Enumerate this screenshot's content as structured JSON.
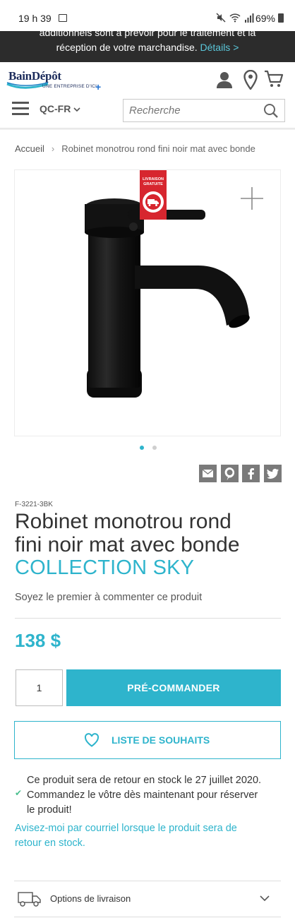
{
  "status_bar": {
    "time": "19 h 39",
    "battery": "69%"
  },
  "banner": {
    "line1": "additionnels sont à prévoir pour le traitement et la",
    "line2": "réception de votre marchandise.",
    "link": "Détails >"
  },
  "header": {
    "logo_text": "BainDépôt",
    "logo_sub": "UNE ENTREPRISE D'ICI",
    "lang": "QC-FR",
    "search_placeholder": "Recherche"
  },
  "breadcrumb": {
    "home": "Accueil",
    "current": "Robinet monotrou rond fini noir mat avec bonde"
  },
  "gallery": {
    "badge_line1": "LIVRAISON",
    "badge_line2": "GRATUITE",
    "active_dot": 0,
    "dot_count": 2,
    "accent": "#2eb4cc",
    "badge_color": "#d7262f"
  },
  "product": {
    "sku": "F-3221-3BK",
    "title_line1": "Robinet monotrou rond",
    "title_line2": "fini noir mat avec bonde",
    "collection": "COLLECTION SKY",
    "review_link": "Soyez le premier à commenter ce produit",
    "price": "138 $",
    "quantity": "1"
  },
  "actions": {
    "preorder": "PRÉ-COMMANDER",
    "wishlist": "LISTE DE SOUHAITS"
  },
  "stock": {
    "line1": "Ce produit sera de retour en stock le 27 juillet 2020.",
    "line2": "Commandez le vôtre dès maintenant pour réserver",
    "line3": "le produit!",
    "notify_line1": "Avisez-moi par courriel lorsque le produit sera de",
    "notify_line2": "retour en stock."
  },
  "delivery": {
    "label": "Options de livraison"
  }
}
